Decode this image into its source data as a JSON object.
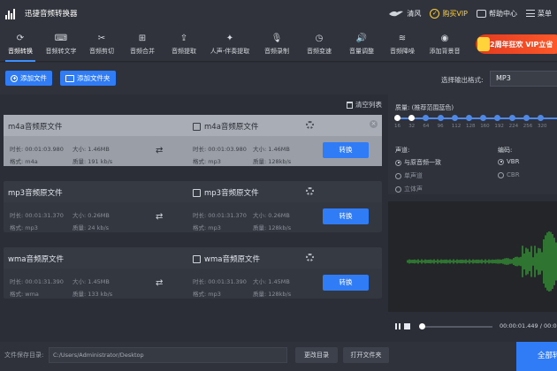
{
  "app": {
    "title": "迅捷音频转换器"
  },
  "titlebar": {
    "items": [
      {
        "label": "清风",
        "icon": "bird-icon"
      },
      {
        "label": "购买VIP",
        "icon": "vip-icon"
      },
      {
        "label": "帮助中心",
        "icon": "help-icon"
      },
      {
        "label": "菜单",
        "icon": "menu-icon"
      }
    ]
  },
  "tools": [
    {
      "label": "音频转换",
      "icon": "convert-icon",
      "glyph": "⟳",
      "active": true
    },
    {
      "label": "音频转文字",
      "icon": "speech-to-text-icon",
      "glyph": "⌨"
    },
    {
      "label": "音频剪切",
      "icon": "scissors-icon",
      "glyph": "✂"
    },
    {
      "label": "音频合并",
      "icon": "merge-icon",
      "glyph": "⊞"
    },
    {
      "label": "音频提取",
      "icon": "extract-icon",
      "glyph": "⇪"
    },
    {
      "label": "人声-伴奏提取",
      "icon": "vocal-extract-icon",
      "glyph": "✦"
    },
    {
      "label": "音频录制",
      "icon": "microphone-icon",
      "glyph": "🎙"
    },
    {
      "label": "音频变速",
      "icon": "speed-icon",
      "glyph": "◷"
    },
    {
      "label": "音量调整",
      "icon": "volume-icon",
      "glyph": "🔊"
    },
    {
      "label": "音频降噪",
      "icon": "denoise-icon",
      "glyph": "≋"
    },
    {
      "label": "添加背景音",
      "icon": "background-music-icon",
      "glyph": "◉"
    }
  ],
  "promo": {
    "label": "2周年狂欢 VIP立省"
  },
  "actions": {
    "add_file": "添加文件",
    "add_folder": "添加文件夹",
    "format_label": "选择输出格式:",
    "format_value": "MP3",
    "clear_list": "清空列表"
  },
  "files": [
    {
      "name": "m4a音频原文件",
      "output_name": "m4a音频原文件",
      "src_duration": "时长: 00:01:03.980",
      "src_size": "大小: 1.46MB",
      "src_format": "格式: m4a",
      "src_quality": "质量: 191 kb/s",
      "out_duration": "时长: 00:01:03.980",
      "out_size": "大小: 1.46MB",
      "out_format": "格式: mp3",
      "out_quality": "质量: 128kb/s",
      "convert": "转换",
      "selected": true
    },
    {
      "name": "mp3音频原文件",
      "output_name": "mp3音频原文件",
      "src_duration": "时长: 00:01:31.370",
      "src_size": "大小: 0.26MB",
      "src_format": "格式: mp3",
      "src_quality": "质量: 24 kb/s",
      "out_duration": "时长: 00:01:31.370",
      "out_size": "大小: 0.26MB",
      "out_format": "格式: mp3",
      "out_quality": "质量: 128kb/s",
      "convert": "转换",
      "selected": false
    },
    {
      "name": "wma音频原文件",
      "output_name": "wma音频原文件",
      "src_duration": "时长: 00:01:31.390",
      "src_size": "大小: 1.45MB",
      "src_format": "格式: wma",
      "src_quality": "质量: 133 kb/s",
      "out_duration": "时长: 00:01:31.390",
      "out_size": "大小: 1.45MB",
      "out_format": "格式: mp3",
      "out_quality": "质量: 128kb/s",
      "convert": "转换",
      "selected": false
    }
  ],
  "settings": {
    "quality_label": "质量: (推荐范围蓝色)",
    "quality_ticks": [
      "16",
      "32",
      "64",
      "96",
      "112",
      "128",
      "160",
      "192",
      "224",
      "256",
      "320"
    ],
    "quality_selected": "128",
    "channel_label": "声道:",
    "channel_options": [
      "与原音频一致",
      "单声道",
      "立体声"
    ],
    "channel_selected": "与原音频一致",
    "encoding_label": "编码:",
    "encoding_options": [
      "VBR",
      "CBR"
    ],
    "encoding_selected": "VBR"
  },
  "player": {
    "time": "00:00:01.449 / 00:01:0"
  },
  "bottom": {
    "save_label": "文件保存目录:",
    "save_path": "C:/Users/Administrator/Desktop",
    "change_dir": "更改目录",
    "open_folder": "打开文件夹",
    "convert_all": "全部转换"
  },
  "colors": {
    "accent": "#2f7cf6",
    "promo": "#e43a1f",
    "vip": "#ffcf3a",
    "wave": "#3ec23a"
  }
}
